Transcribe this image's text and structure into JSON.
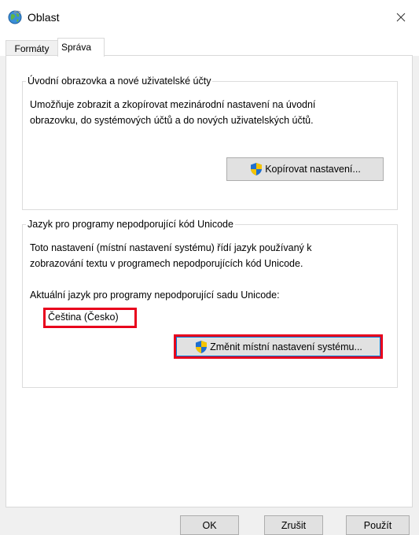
{
  "window": {
    "title": "Oblast",
    "close_label": "×"
  },
  "tabs": [
    {
      "label": "Formáty",
      "selected": false
    },
    {
      "label": "Správa",
      "selected": true
    }
  ],
  "group_welcome": {
    "title": "Úvodní obrazovka a nové uživatelské účty",
    "line1": "Umožňuje zobrazit a zkopírovat mezinárodní nastavení na úvodní",
    "line2": "obrazovku, do systémových účtů a do nových uživatelských účtů.",
    "copy_button": "Kopírovat nastavení..."
  },
  "group_unicode": {
    "title": "Jazyk pro programy nepodporující kód Unicode",
    "line1": "Toto nastavení (místní nastavení systému) řídí jazyk používaný k",
    "line2": "zobrazování textu v programech nepodporujících kód Unicode.",
    "current_label": "Aktuální jazyk pro programy nepodporující sadu Unicode:",
    "current_value": "Čeština (Česko)",
    "change_button": "Změnit místní nastavení systému..."
  },
  "footer": {
    "ok": "OK",
    "cancel": "Zrušit",
    "apply": "Použít"
  },
  "colors": {
    "highlight": "#e8001c",
    "focus_border": "#0078d7"
  },
  "icons": {
    "title": "globe-icon",
    "shield": "uac-shield-icon"
  }
}
